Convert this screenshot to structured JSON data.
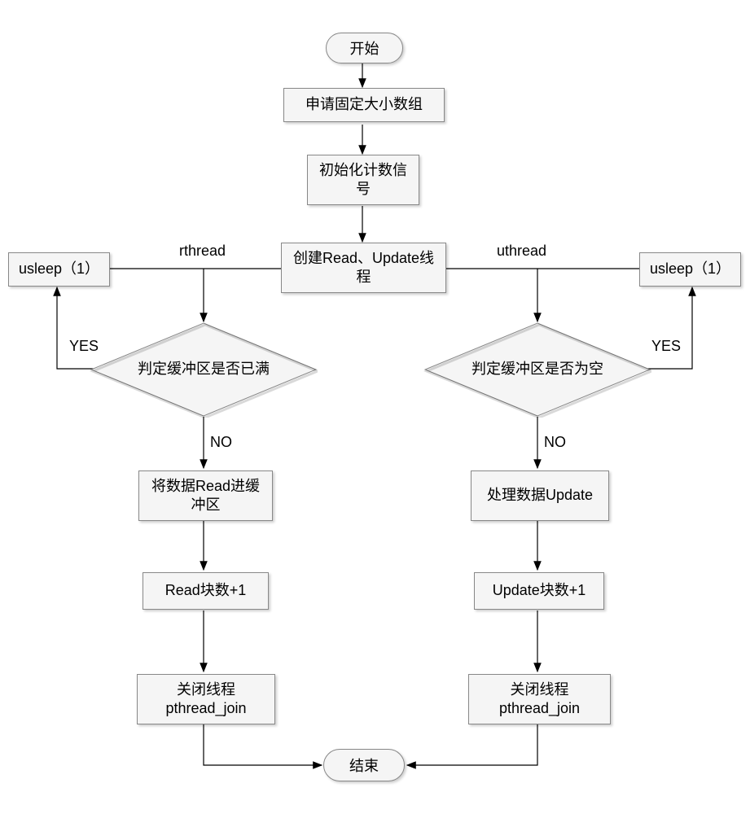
{
  "terminals": {
    "start": "开始",
    "end": "结束"
  },
  "processes": {
    "alloc_array": "申请固定大小数组",
    "init_counter": "初始化计数信号",
    "create_threads": "创建Read、Update线程",
    "usleep_left": "usleep（1）",
    "usleep_right": "usleep（1）",
    "read_into_buffer": "将数据Read进缓冲区",
    "read_inc": "Read块数+1",
    "close_left": "关闭线程pthread_join",
    "process_update": "处理数据Update",
    "update_inc": "Update块数+1",
    "close_right": "关闭线程pthread_join"
  },
  "decisions": {
    "buffer_full": "判定缓冲区是否已满",
    "buffer_empty": "判定缓冲区是否为空"
  },
  "edge_labels": {
    "rthread": "rthread",
    "uthread": "uthread",
    "yes_left": "YES",
    "yes_right": "YES",
    "no_left": "NO",
    "no_right": "NO"
  },
  "chart_data": {
    "type": "flowchart",
    "nodes": [
      {
        "id": "start",
        "kind": "terminal",
        "label": "开始"
      },
      {
        "id": "alloc_array",
        "kind": "process",
        "label": "申请固定大小数组"
      },
      {
        "id": "init_counter",
        "kind": "process",
        "label": "初始化计数信号"
      },
      {
        "id": "create_threads",
        "kind": "process",
        "label": "创建Read、Update线程"
      },
      {
        "id": "usleep_left",
        "kind": "process",
        "label": "usleep（1）"
      },
      {
        "id": "usleep_right",
        "kind": "process",
        "label": "usleep（1）"
      },
      {
        "id": "buffer_full",
        "kind": "decision",
        "label": "判定缓冲区是否已满"
      },
      {
        "id": "buffer_empty",
        "kind": "decision",
        "label": "判定缓冲区是否为空"
      },
      {
        "id": "read_into_buffer",
        "kind": "process",
        "label": "将数据Read进缓冲区"
      },
      {
        "id": "read_inc",
        "kind": "process",
        "label": "Read块数+1"
      },
      {
        "id": "close_left",
        "kind": "process",
        "label": "关闭线程pthread_join"
      },
      {
        "id": "process_update",
        "kind": "process",
        "label": "处理数据Update"
      },
      {
        "id": "update_inc",
        "kind": "process",
        "label": "Update块数+1"
      },
      {
        "id": "close_right",
        "kind": "process",
        "label": "关闭线程pthread_join"
      },
      {
        "id": "end",
        "kind": "terminal",
        "label": "结束"
      }
    ],
    "edges": [
      {
        "from": "start",
        "to": "alloc_array"
      },
      {
        "from": "alloc_array",
        "to": "init_counter"
      },
      {
        "from": "init_counter",
        "to": "create_threads"
      },
      {
        "from": "create_threads",
        "to": "buffer_full",
        "label": "rthread"
      },
      {
        "from": "create_threads",
        "to": "buffer_empty",
        "label": "uthread"
      },
      {
        "from": "create_threads",
        "to": "usleep_left"
      },
      {
        "from": "create_threads",
        "to": "usleep_right"
      },
      {
        "from": "buffer_full",
        "to": "usleep_left",
        "label": "YES"
      },
      {
        "from": "buffer_full",
        "to": "read_into_buffer",
        "label": "NO"
      },
      {
        "from": "buffer_empty",
        "to": "usleep_right",
        "label": "YES"
      },
      {
        "from": "buffer_empty",
        "to": "process_update",
        "label": "NO"
      },
      {
        "from": "read_into_buffer",
        "to": "read_inc"
      },
      {
        "from": "read_inc",
        "to": "close_left"
      },
      {
        "from": "process_update",
        "to": "update_inc"
      },
      {
        "from": "update_inc",
        "to": "close_right"
      },
      {
        "from": "close_left",
        "to": "end"
      },
      {
        "from": "close_right",
        "to": "end"
      }
    ]
  }
}
